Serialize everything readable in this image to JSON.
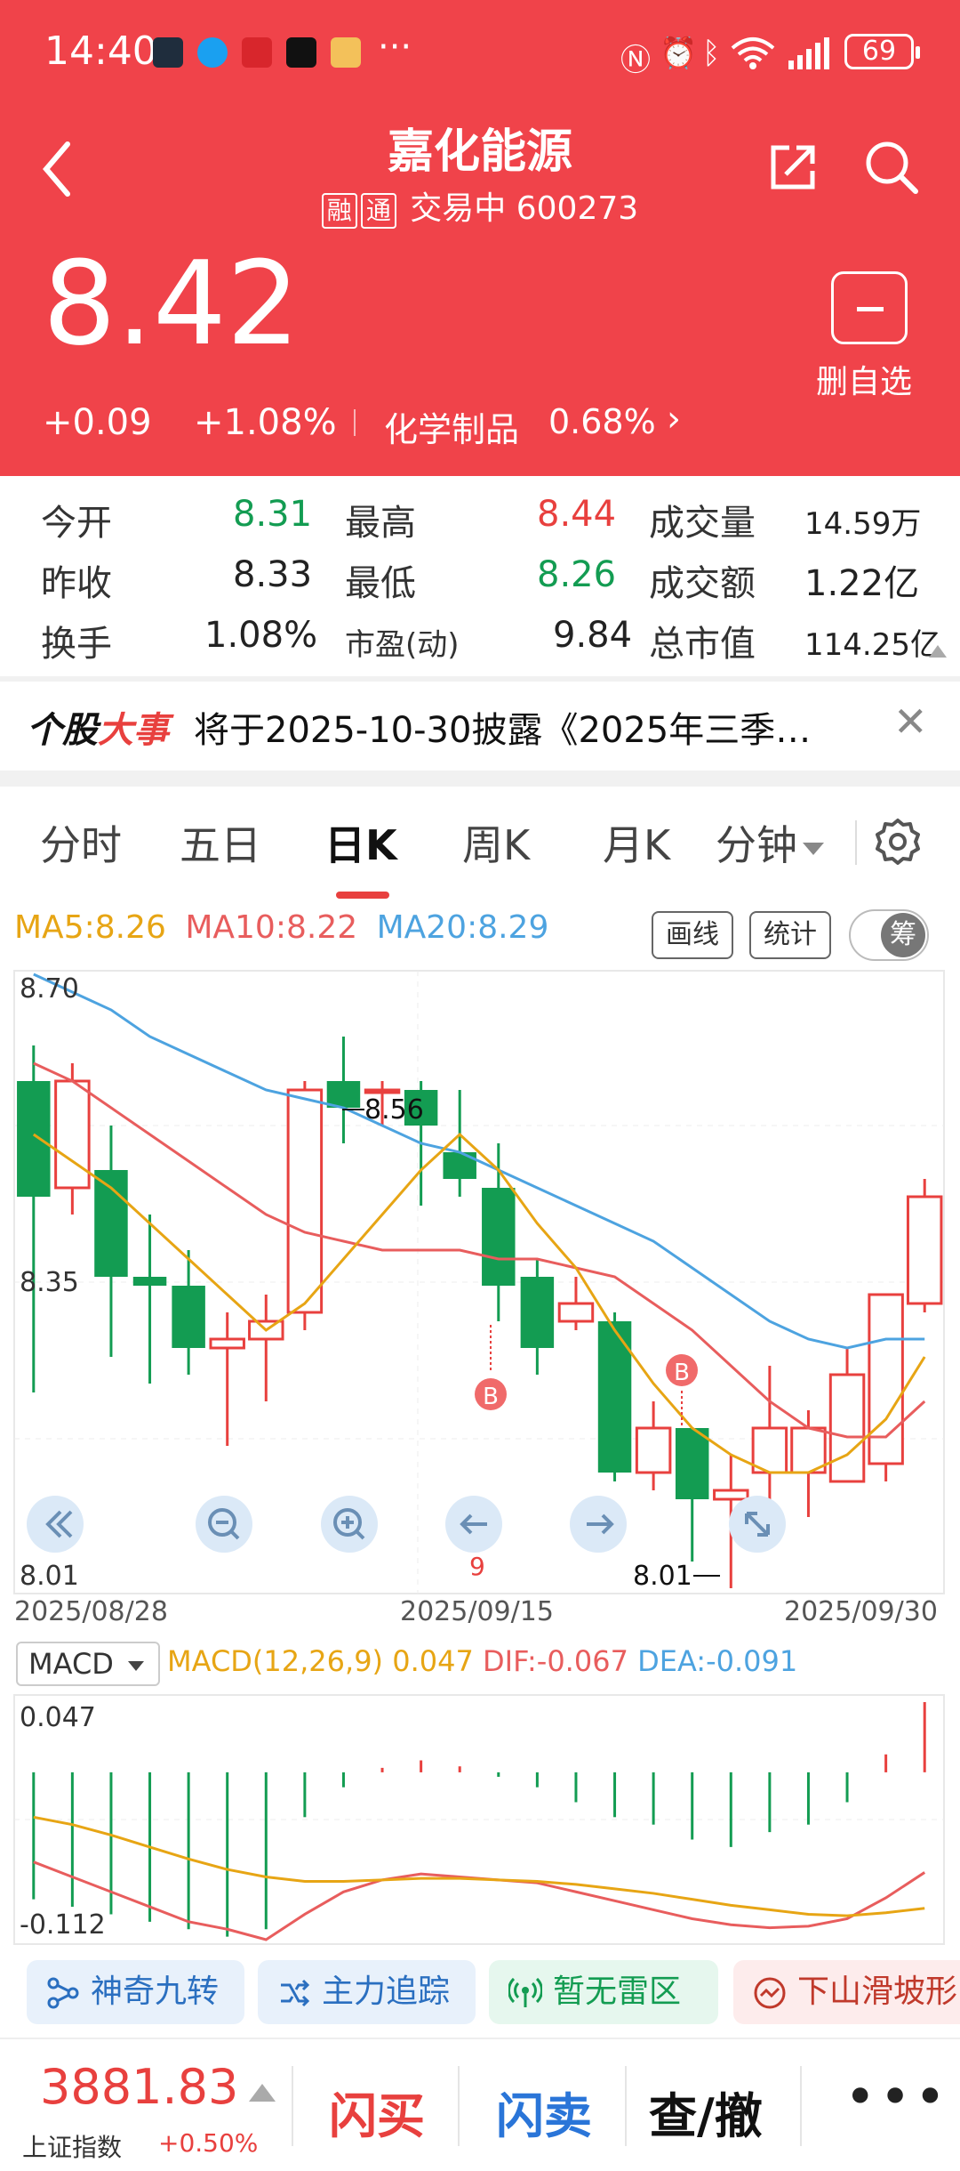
{
  "status_bar": {
    "time": "14:40",
    "dots": "···",
    "battery": "69"
  },
  "header": {
    "title": "嘉化能源",
    "tag1": "融",
    "tag2": "通",
    "trading_status": "交易中",
    "code": "600273",
    "price": "8.42",
    "change": "+0.09",
    "change_pct": "+1.08%",
    "sector": "化学制品",
    "sector_pct": "0.68%",
    "remove_watch": "删自选"
  },
  "quote": {
    "open_label": "今开",
    "open": "8.31",
    "high_label": "最高",
    "high": "8.44",
    "volume_label": "成交量",
    "volume": "14.59万",
    "prev_close_label": "昨收",
    "prev_close": "8.33",
    "low_label": "最低",
    "low": "8.26",
    "amount_label": "成交额",
    "amount": "1.22亿",
    "turnover_label": "换手",
    "turnover": "1.08%",
    "pe_label": "市盈(动)",
    "pe": "9.84",
    "mcap_label": "总市值",
    "mcap": "114.25亿"
  },
  "news": {
    "tag_a": "个股",
    "tag_b": "大事",
    "text": "将于2025-10-30披露《2025年三季…"
  },
  "tabs": [
    {
      "label": "分时"
    },
    {
      "label": "五日"
    },
    {
      "label": "日K"
    },
    {
      "label": "周K"
    },
    {
      "label": "月K"
    },
    {
      "label": "分钟"
    }
  ],
  "ma": {
    "ma5": "MA5:8.26",
    "ma10": "MA10:8.22",
    "ma20": "MA20:8.29"
  },
  "tools": {
    "draw": "画线",
    "stats": "统计",
    "chip": "筹"
  },
  "colors": {
    "up": "#e8403e",
    "down": "#139c52",
    "ma5": "#e7a514",
    "ma10": "#e85d5d",
    "ma20": "#4da3e0"
  },
  "chart_data": [
    {
      "type": "candlestick",
      "y_labels": [
        "8.70",
        "8.35",
        "8.01"
      ],
      "ylim": [
        8.01,
        8.7
      ],
      "x_labels": [
        "2025/08/28",
        "2025/09/15",
        "2025/09/30"
      ],
      "annotations": {
        "max_label": "8.56",
        "min_label": "8.01",
        "marker": "B",
        "count": "9"
      },
      "candles": [
        {
          "o": 8.58,
          "h": 8.62,
          "l": 8.23,
          "c": 8.45
        },
        {
          "o": 8.46,
          "h": 8.6,
          "l": 8.43,
          "c": 8.58
        },
        {
          "o": 8.48,
          "h": 8.53,
          "l": 8.27,
          "c": 8.36
        },
        {
          "o": 8.36,
          "h": 8.43,
          "l": 8.24,
          "c": 8.35
        },
        {
          "o": 8.35,
          "h": 8.39,
          "l": 8.25,
          "c": 8.28
        },
        {
          "o": 8.28,
          "h": 8.32,
          "l": 8.17,
          "c": 8.29
        },
        {
          "o": 8.29,
          "h": 8.34,
          "l": 8.22,
          "c": 8.31
        },
        {
          "o": 8.32,
          "h": 8.58,
          "l": 8.3,
          "c": 8.57
        },
        {
          "o": 8.58,
          "h": 8.63,
          "l": 8.51,
          "c": 8.55
        },
        {
          "o": 8.57,
          "h": 8.58,
          "l": 8.53,
          "c": 8.57
        },
        {
          "o": 8.57,
          "h": 8.58,
          "l": 8.44,
          "c": 8.53
        },
        {
          "o": 8.5,
          "h": 8.57,
          "l": 8.45,
          "c": 8.47
        },
        {
          "o": 8.46,
          "h": 8.51,
          "l": 8.31,
          "c": 8.35
        },
        {
          "o": 8.36,
          "h": 8.38,
          "l": 8.25,
          "c": 8.28
        },
        {
          "o": 8.31,
          "h": 8.36,
          "l": 8.3,
          "c": 8.33
        },
        {
          "o": 8.31,
          "h": 8.32,
          "l": 8.13,
          "c": 8.14
        },
        {
          "o": 8.14,
          "h": 8.22,
          "l": 8.12,
          "c": 8.19
        },
        {
          "o": 8.19,
          "h": 8.19,
          "l": 8.04,
          "c": 8.11
        },
        {
          "o": 8.11,
          "h": 8.16,
          "l": 8.01,
          "c": 8.12
        },
        {
          "o": 8.14,
          "h": 8.26,
          "l": 8.08,
          "c": 8.19
        },
        {
          "o": 8.14,
          "h": 8.21,
          "l": 8.09,
          "c": 8.19
        },
        {
          "o": 8.13,
          "h": 8.28,
          "l": 8.13,
          "c": 8.25
        },
        {
          "o": 8.15,
          "h": 8.33,
          "l": 8.13,
          "c": 8.34
        },
        {
          "o": 8.33,
          "h": 8.47,
          "l": 8.32,
          "c": 8.45
        }
      ],
      "ma5": [
        8.52,
        8.49,
        8.46,
        8.42,
        8.38,
        8.34,
        8.3,
        8.33,
        8.38,
        8.43,
        8.48,
        8.52,
        8.48,
        8.42,
        8.37,
        8.3,
        8.24,
        8.19,
        8.16,
        8.14,
        8.14,
        8.16,
        8.2,
        8.27
      ],
      "ma10": [
        8.6,
        8.58,
        8.55,
        8.52,
        8.49,
        8.46,
        8.43,
        8.41,
        8.4,
        8.39,
        8.39,
        8.39,
        8.38,
        8.38,
        8.37,
        8.36,
        8.33,
        8.3,
        8.26,
        8.22,
        8.19,
        8.18,
        8.18,
        8.22
      ],
      "ma20": [
        8.7,
        8.68,
        8.66,
        8.63,
        8.61,
        8.59,
        8.57,
        8.56,
        8.55,
        8.53,
        8.51,
        8.5,
        8.48,
        8.46,
        8.44,
        8.42,
        8.4,
        8.37,
        8.34,
        8.31,
        8.29,
        8.28,
        8.29,
        8.29
      ]
    },
    {
      "type": "macd",
      "title": "MACD",
      "params": "MACD(12,26,9)",
      "macd_value": "0.047",
      "dif": "DIF:-0.067",
      "dea": "DEA:-0.091",
      "y_labels": [
        "0.047",
        "-0.112"
      ],
      "ylim": [
        -0.112,
        0.047
      ],
      "hist": [
        -0.085,
        -0.09,
        -0.095,
        -0.1,
        -0.105,
        -0.11,
        -0.105,
        -0.03,
        -0.01,
        0.003,
        0.008,
        0.004,
        -0.003,
        -0.01,
        -0.02,
        -0.03,
        -0.035,
        -0.045,
        -0.05,
        -0.04,
        -0.035,
        -0.02,
        0.012,
        0.047
      ],
      "dif_line": [
        -0.06,
        -0.07,
        -0.08,
        -0.09,
        -0.1,
        -0.105,
        -0.112,
        -0.095,
        -0.08,
        -0.072,
        -0.068,
        -0.07,
        -0.072,
        -0.074,
        -0.08,
        -0.086,
        -0.092,
        -0.098,
        -0.102,
        -0.104,
        -0.103,
        -0.098,
        -0.084,
        -0.067
      ],
      "dea_line": [
        -0.03,
        -0.035,
        -0.042,
        -0.05,
        -0.058,
        -0.065,
        -0.07,
        -0.073,
        -0.073,
        -0.072,
        -0.071,
        -0.071,
        -0.072,
        -0.073,
        -0.075,
        -0.078,
        -0.081,
        -0.085,
        -0.089,
        -0.092,
        -0.095,
        -0.096,
        -0.094,
        -0.091
      ]
    }
  ],
  "nav": {
    "back": "〈",
    "zoom_out": "−",
    "zoom_in": "+"
  },
  "chips": [
    {
      "label": "神奇九转"
    },
    {
      "label": "主力追踪"
    },
    {
      "label": "暂无雷区"
    },
    {
      "label": "下山滑坡形"
    }
  ],
  "bottom": {
    "index_value": "3881.83",
    "index_name": "上证指数",
    "index_pct": "+0.50%",
    "buy": "闪买",
    "sell": "闪卖",
    "query": "查/撤",
    "more": "•••"
  }
}
